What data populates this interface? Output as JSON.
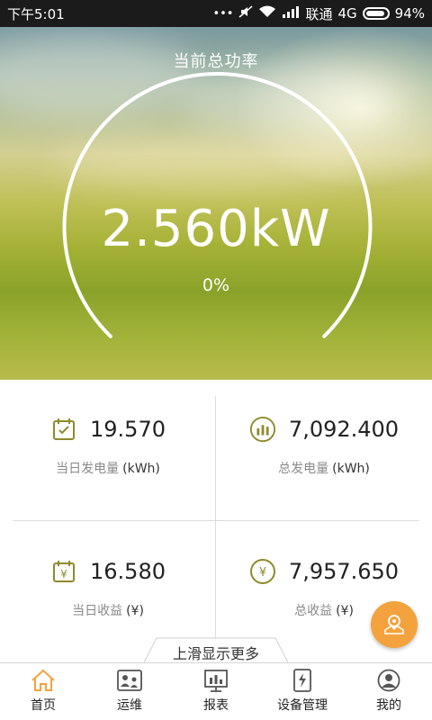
{
  "status_bar": {
    "time": "下午5:01",
    "carrier": "联通",
    "network": "4G",
    "battery": "94%",
    "battery_level": 0.94
  },
  "hero": {
    "title": "当前总功率",
    "power": "2.560kW",
    "percent": "0%",
    "percent_value": 0
  },
  "stats": {
    "daily_generation": {
      "value": "19.570",
      "label": "当日发电量",
      "unit": "(kWh)",
      "icon": "calendar-check-icon"
    },
    "total_generation": {
      "value": "7,092.400",
      "label": "总发电量",
      "unit": "(kWh)",
      "icon": "bar-chart-icon"
    },
    "daily_income": {
      "value": "16.580",
      "label": "当日收益",
      "unit": "(¥)",
      "icon": "calendar-yen-icon"
    },
    "total_income": {
      "value": "7,957.650",
      "label": "总收益",
      "unit": "(¥)",
      "icon": "yen-circle-icon"
    }
  },
  "slide_hint": "上滑显示更多",
  "nav": {
    "items": [
      {
        "label": "首页",
        "icon": "home-icon",
        "active": true
      },
      {
        "label": "运维",
        "icon": "maintenance-icon"
      },
      {
        "label": "报表",
        "icon": "report-icon"
      },
      {
        "label": "设备管理",
        "icon": "device-icon"
      },
      {
        "label": "我的",
        "icon": "profile-icon"
      }
    ]
  },
  "colors": {
    "accent": "#f4a23d",
    "icon_olive": "#8e8a2d",
    "nav_active": "#f4a23d"
  }
}
